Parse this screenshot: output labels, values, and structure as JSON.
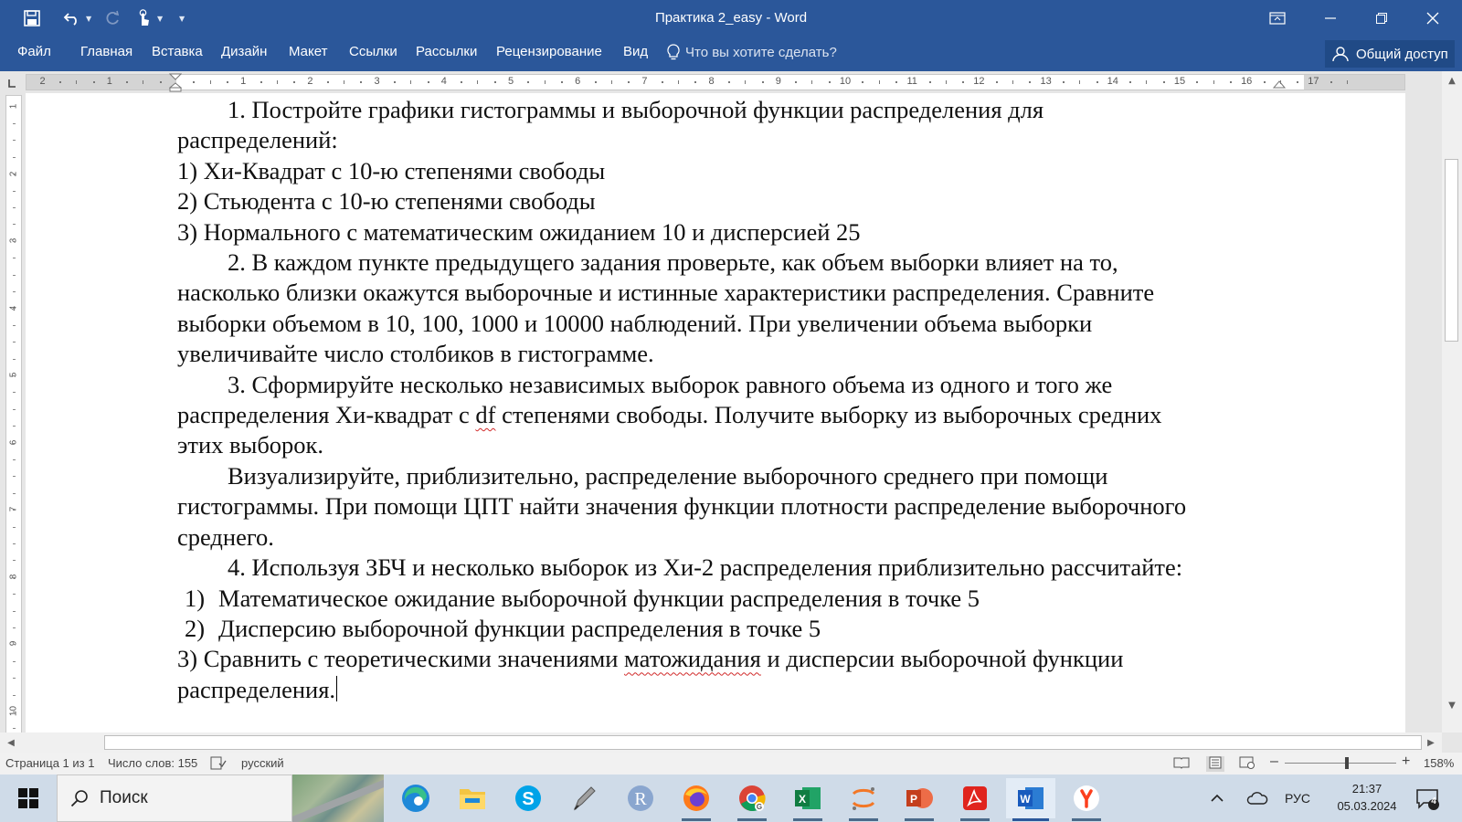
{
  "window": {
    "title": "Практика 2_easy - Word",
    "accent": "#2b579a"
  },
  "ribbon": {
    "tabs": [
      "Файл",
      "Главная",
      "Вставка",
      "Дизайн",
      "Макет",
      "Ссылки",
      "Рассылки",
      "Рецензирование",
      "Вид"
    ],
    "tell_me": "Что вы хотите сделать?",
    "share": "Общий доступ"
  },
  "ruler": {
    "h_labels": [
      "2",
      "1",
      "1",
      "2",
      "3",
      "4",
      "5",
      "6",
      "7",
      "8",
      "9",
      "10",
      "11",
      "12",
      "13",
      "14",
      "15",
      "16",
      "17"
    ],
    "v_labels": [
      "1",
      "2",
      "3",
      "4",
      "5",
      "6",
      "7",
      "8",
      "9",
      "10"
    ]
  },
  "document": {
    "lines": [
      {
        "text": "1. Постройте графики гистограммы и выборочной функции распределения для",
        "style": "indent"
      },
      {
        "text": "распределений:",
        "style": "plain"
      },
      {
        "text": "1) Хи-Квадрат с 10-ю степенями свободы",
        "style": "plain"
      },
      {
        "text": "2) Стьюдента с 10-ю степенями свободы",
        "style": "plain"
      },
      {
        "text": "3) Нормального с математическим ожиданием 10 и дисперсией 25",
        "style": "plain"
      },
      {
        "text": "2. В каждом пункте предыдущего задания проверьте, как объем выборки влияет на то,",
        "style": "indent"
      },
      {
        "text": "насколько близки окажутся выборочные и истинные характеристики распределения. Сравните",
        "style": "plain"
      },
      {
        "text": "выборки объемом в 10, 100, 1000 и 10000 наблюдений. При увеличении объема выборки",
        "style": "plain"
      },
      {
        "text": "увеличивайте число столбиков в гистограмме.",
        "style": "plain"
      },
      {
        "text": "3. Сформируйте несколько независимых выборок равного объема из одного и того же",
        "style": "indent"
      },
      {
        "pre": "распределения Хи-квадрат с ",
        "squig": "df",
        "post": " степенями свободы. Получите выборку из выборочных средних",
        "style": "plain"
      },
      {
        "text": "этих выборок.",
        "style": "plain"
      },
      {
        "text": "Визуализируйте, приблизительно, распределение выборочного среднего при помощи",
        "style": "indent"
      },
      {
        "text": "гистограммы. При помощи ЦПТ найти значения функции плотности распределение выборочного",
        "style": "plain"
      },
      {
        "text": "среднего.",
        "style": "plain"
      },
      {
        "text": "4. Используя ЗБЧ и несколько выборок из Хи-2 распределения приблизительно рассчитайте:",
        "style": "indent"
      },
      {
        "num": "1)",
        "text": "Математическое ожидание выборочной функции распределения в точке 5",
        "style": "list"
      },
      {
        "num": "2)",
        "text": "Дисперсию выборочной функции распределения в точке 5",
        "style": "list"
      },
      {
        "pre": "3) Сравнить с теоретическими значениями ",
        "squig": "матожидания",
        "post": " и дисперсии выборочной функции",
        "style": "plain"
      },
      {
        "text": "распределения.",
        "style": "cursor"
      }
    ]
  },
  "statusbar": {
    "page": "Страница 1 из 1",
    "words": "Число слов: 155",
    "language": "русский",
    "zoom": "158%"
  },
  "taskbar": {
    "search_placeholder": "Поиск",
    "lang": "РУС",
    "time": "21:37",
    "date": "05.03.2024",
    "notifications": "4",
    "apps": [
      "edge-icon",
      "explorer-icon",
      "skype-icon",
      "pen-icon",
      "r-icon",
      "firefox-icon",
      "chrome-icon",
      "excel-icon",
      "jupyter-icon",
      "powerpoint-icon",
      "acrobat-icon",
      "word-icon",
      "yandex-icon"
    ]
  }
}
